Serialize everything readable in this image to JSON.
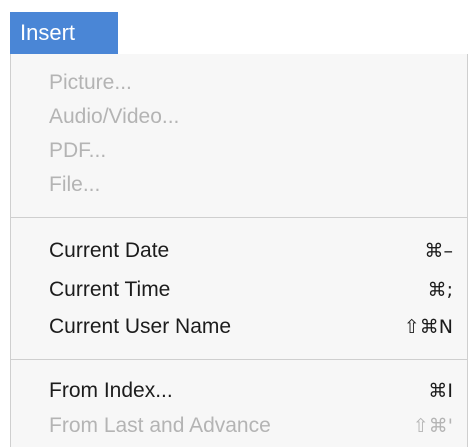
{
  "menu": {
    "title": "Insert",
    "items": [
      {
        "label": "Picture...",
        "shortcut": "",
        "enabled": false
      },
      {
        "label": "Audio/Video...",
        "shortcut": "",
        "enabled": false
      },
      {
        "label": "PDF...",
        "shortcut": "",
        "enabled": false
      },
      {
        "label": "File...",
        "shortcut": "",
        "enabled": false
      },
      {
        "label": "Current Date",
        "shortcut": "⌘–",
        "enabled": true
      },
      {
        "label": "Current Time",
        "shortcut": "⌘;",
        "enabled": true
      },
      {
        "label": "Current User Name",
        "shortcut": "⇧⌘N",
        "enabled": true
      },
      {
        "label": "From Index...",
        "shortcut": "⌘I",
        "enabled": true
      },
      {
        "label": "From Last and Advance",
        "shortcut": "⇧⌘'",
        "enabled": false
      }
    ]
  },
  "colors": {
    "menubar_highlight": "#4a86d6",
    "enabled_text": "#1c1c1c",
    "disabled_text": "#b4b4b4",
    "menu_background": "#f7f7f7"
  }
}
